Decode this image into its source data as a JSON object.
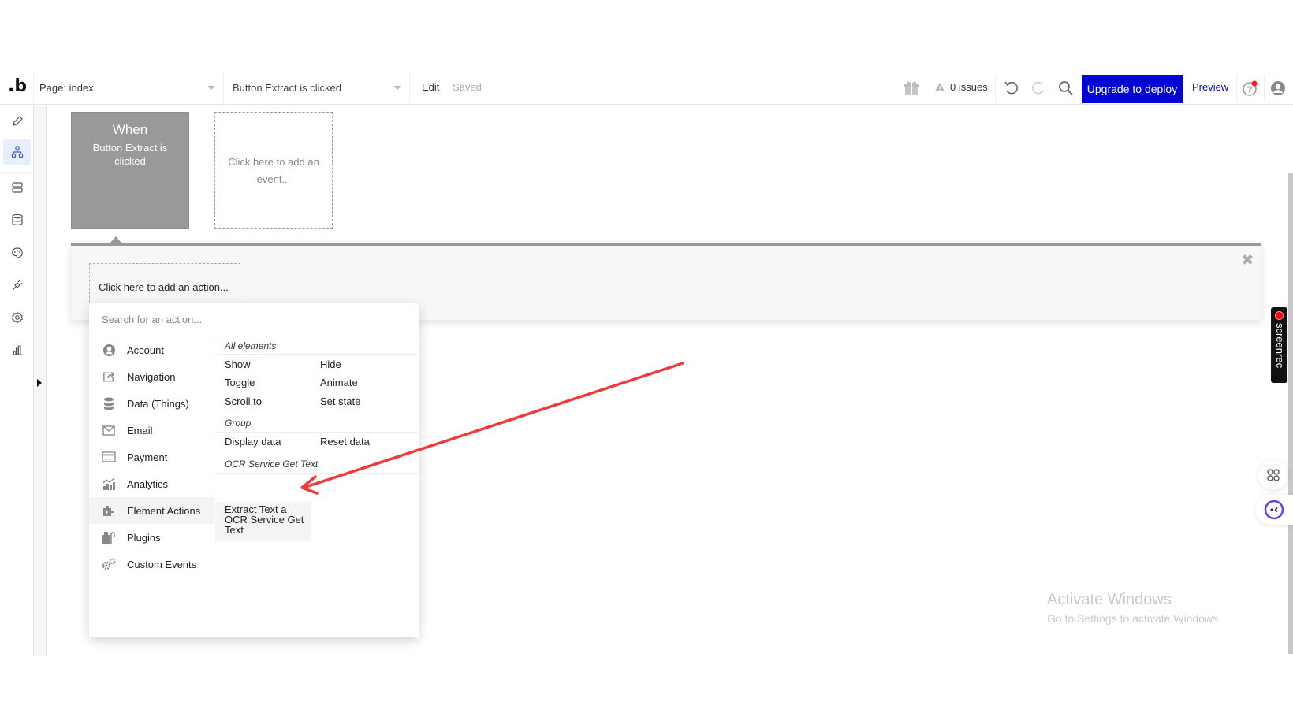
{
  "topbar": {
    "logo": ".b",
    "page_select": "Page: index",
    "event_select": "Button Extract is clicked",
    "edit_label": "Edit",
    "saved_label": "Saved",
    "issues_label": "0 issues",
    "upgrade_label": "Upgrade to deploy",
    "preview_label": "Preview",
    "colors": {
      "upgrade_bg": "#0205d3",
      "notification_dot": "#ff1a1a"
    }
  },
  "sidebar": {
    "items": [
      {
        "name": "design",
        "icon": "pencil-icon",
        "active": false
      },
      {
        "name": "workflow",
        "icon": "workflow-icon",
        "active": true
      },
      {
        "name": "data",
        "icon": "data-icon",
        "active": false
      },
      {
        "name": "database",
        "icon": "database-icon",
        "active": false
      },
      {
        "name": "styles",
        "icon": "palette-icon",
        "active": false
      },
      {
        "name": "plugins",
        "icon": "plug-icon",
        "active": false
      },
      {
        "name": "settings",
        "icon": "gear-icon",
        "active": false
      },
      {
        "name": "logs",
        "icon": "bar-chart-icon",
        "active": false
      }
    ]
  },
  "canvas": {
    "event_card": {
      "title": "When",
      "name": "Button Extract is clicked"
    },
    "add_event": "Click here to add an event...",
    "add_action": "Click here to add an action..."
  },
  "action_menu": {
    "search_placeholder": "Search for an action...",
    "categories": [
      {
        "label": "Account",
        "icon": "account-icon"
      },
      {
        "label": "Navigation",
        "icon": "navigation-icon"
      },
      {
        "label": "Data (Things)",
        "icon": "database-icon"
      },
      {
        "label": "Email",
        "icon": "email-icon"
      },
      {
        "label": "Payment",
        "icon": "credit-card-icon"
      },
      {
        "label": "Analytics",
        "icon": "analytics-icon"
      },
      {
        "label": "Element Actions",
        "icon": "element-actions-icon",
        "active": true
      },
      {
        "label": "Plugins",
        "icon": "plugins-icon"
      },
      {
        "label": "Custom Events",
        "icon": "gears-icon"
      }
    ],
    "groups": [
      {
        "title": "All elements",
        "actions": [
          "Show",
          "Hide",
          "Toggle",
          "Animate",
          "Scroll to",
          "Set state"
        ]
      },
      {
        "title": "Group",
        "actions": [
          "Display data",
          "Reset data"
        ]
      },
      {
        "title": "OCR Service Get Text",
        "actions": [
          "Extract Text a OCR Service Get Text"
        ]
      }
    ]
  },
  "overlay": {
    "screenrec_label": "screenrec",
    "activate_title": "Activate Windows",
    "activate_subtitle": "Go to Settings to activate Windows.",
    "annotation_arrow_color": "#f03a3a"
  }
}
